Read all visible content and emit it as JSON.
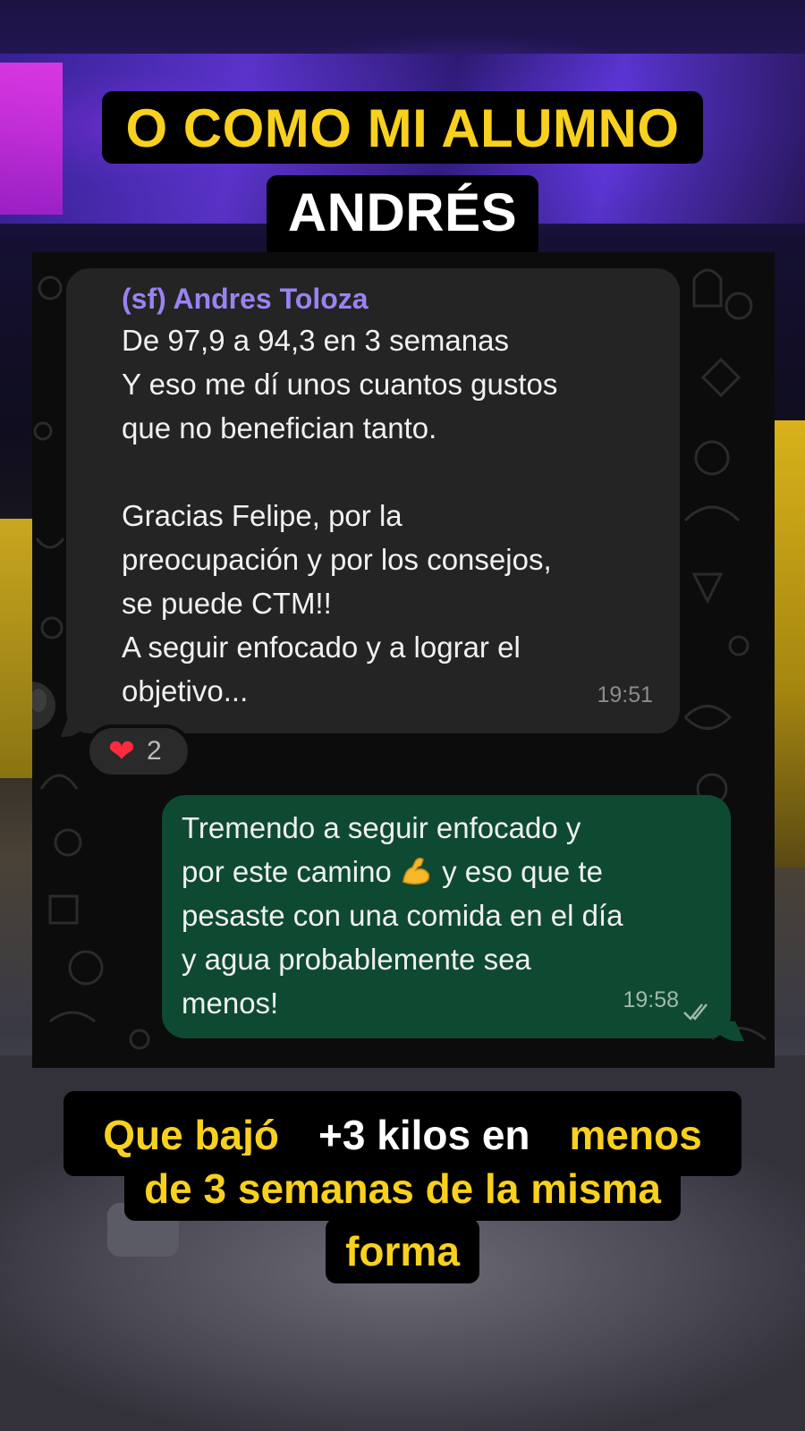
{
  "headline": {
    "line1": "O COMO MI ALUMNO",
    "line2": "ANDRÉS"
  },
  "chat": {
    "incoming": {
      "sender": "(sf) Andres Toloza",
      "lines": [
        "De 97,9 a 94,3 en 3 semanas",
        "Y eso me dí unos cuantos gustos",
        "que no benefician tanto.",
        "",
        "Gracias Felipe, por la",
        "preocupación y por los consejos,",
        "se puede CTM!!",
        "A seguir enfocado y a lograr el",
        "objetivo..."
      ],
      "time": "19:51",
      "reaction": {
        "icon": "heart-emoji",
        "count": "2"
      }
    },
    "outgoing": {
      "line1": "Tremendo a seguir enfocado y",
      "line2_before": "por este camino ",
      "line2_emoji": "flexed-biceps-emoji",
      "line2_after": " y eso que te",
      "line3": "pesaste con una comida en el día",
      "line4": "y agua probablemente sea",
      "line5": "menos!",
      "time": "19:58",
      "status_icon": "double-check-icon"
    }
  },
  "caption": {
    "l1_a": "Que bajó ",
    "l1_b": "+3 kilos en ",
    "l1_c": "menos",
    "l2": "de 3 semanas de la misma",
    "l3": "forma"
  },
  "colors": {
    "accent_yellow": "#f8d01e",
    "sender_purple": "#9b82f2",
    "incoming_bubble": "#242424",
    "outgoing_bubble": "#0e4a32"
  }
}
